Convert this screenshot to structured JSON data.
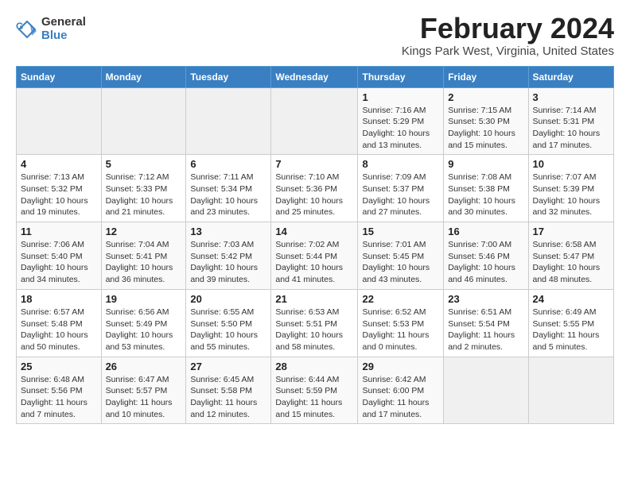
{
  "logo": {
    "general": "General",
    "blue": "Blue"
  },
  "title": "February 2024",
  "subtitle": "Kings Park West, Virginia, United States",
  "days_of_week": [
    "Sunday",
    "Monday",
    "Tuesday",
    "Wednesday",
    "Thursday",
    "Friday",
    "Saturday"
  ],
  "weeks": [
    [
      {
        "day": "",
        "info": ""
      },
      {
        "day": "",
        "info": ""
      },
      {
        "day": "",
        "info": ""
      },
      {
        "day": "",
        "info": ""
      },
      {
        "day": "1",
        "info": "Sunrise: 7:16 AM\nSunset: 5:29 PM\nDaylight: 10 hours\nand 13 minutes."
      },
      {
        "day": "2",
        "info": "Sunrise: 7:15 AM\nSunset: 5:30 PM\nDaylight: 10 hours\nand 15 minutes."
      },
      {
        "day": "3",
        "info": "Sunrise: 7:14 AM\nSunset: 5:31 PM\nDaylight: 10 hours\nand 17 minutes."
      }
    ],
    [
      {
        "day": "4",
        "info": "Sunrise: 7:13 AM\nSunset: 5:32 PM\nDaylight: 10 hours\nand 19 minutes."
      },
      {
        "day": "5",
        "info": "Sunrise: 7:12 AM\nSunset: 5:33 PM\nDaylight: 10 hours\nand 21 minutes."
      },
      {
        "day": "6",
        "info": "Sunrise: 7:11 AM\nSunset: 5:34 PM\nDaylight: 10 hours\nand 23 minutes."
      },
      {
        "day": "7",
        "info": "Sunrise: 7:10 AM\nSunset: 5:36 PM\nDaylight: 10 hours\nand 25 minutes."
      },
      {
        "day": "8",
        "info": "Sunrise: 7:09 AM\nSunset: 5:37 PM\nDaylight: 10 hours\nand 27 minutes."
      },
      {
        "day": "9",
        "info": "Sunrise: 7:08 AM\nSunset: 5:38 PM\nDaylight: 10 hours\nand 30 minutes."
      },
      {
        "day": "10",
        "info": "Sunrise: 7:07 AM\nSunset: 5:39 PM\nDaylight: 10 hours\nand 32 minutes."
      }
    ],
    [
      {
        "day": "11",
        "info": "Sunrise: 7:06 AM\nSunset: 5:40 PM\nDaylight: 10 hours\nand 34 minutes."
      },
      {
        "day": "12",
        "info": "Sunrise: 7:04 AM\nSunset: 5:41 PM\nDaylight: 10 hours\nand 36 minutes."
      },
      {
        "day": "13",
        "info": "Sunrise: 7:03 AM\nSunset: 5:42 PM\nDaylight: 10 hours\nand 39 minutes."
      },
      {
        "day": "14",
        "info": "Sunrise: 7:02 AM\nSunset: 5:44 PM\nDaylight: 10 hours\nand 41 minutes."
      },
      {
        "day": "15",
        "info": "Sunrise: 7:01 AM\nSunset: 5:45 PM\nDaylight: 10 hours\nand 43 minutes."
      },
      {
        "day": "16",
        "info": "Sunrise: 7:00 AM\nSunset: 5:46 PM\nDaylight: 10 hours\nand 46 minutes."
      },
      {
        "day": "17",
        "info": "Sunrise: 6:58 AM\nSunset: 5:47 PM\nDaylight: 10 hours\nand 48 minutes."
      }
    ],
    [
      {
        "day": "18",
        "info": "Sunrise: 6:57 AM\nSunset: 5:48 PM\nDaylight: 10 hours\nand 50 minutes."
      },
      {
        "day": "19",
        "info": "Sunrise: 6:56 AM\nSunset: 5:49 PM\nDaylight: 10 hours\nand 53 minutes."
      },
      {
        "day": "20",
        "info": "Sunrise: 6:55 AM\nSunset: 5:50 PM\nDaylight: 10 hours\nand 55 minutes."
      },
      {
        "day": "21",
        "info": "Sunrise: 6:53 AM\nSunset: 5:51 PM\nDaylight: 10 hours\nand 58 minutes."
      },
      {
        "day": "22",
        "info": "Sunrise: 6:52 AM\nSunset: 5:53 PM\nDaylight: 11 hours\nand 0 minutes."
      },
      {
        "day": "23",
        "info": "Sunrise: 6:51 AM\nSunset: 5:54 PM\nDaylight: 11 hours\nand 2 minutes."
      },
      {
        "day": "24",
        "info": "Sunrise: 6:49 AM\nSunset: 5:55 PM\nDaylight: 11 hours\nand 5 minutes."
      }
    ],
    [
      {
        "day": "25",
        "info": "Sunrise: 6:48 AM\nSunset: 5:56 PM\nDaylight: 11 hours\nand 7 minutes."
      },
      {
        "day": "26",
        "info": "Sunrise: 6:47 AM\nSunset: 5:57 PM\nDaylight: 11 hours\nand 10 minutes."
      },
      {
        "day": "27",
        "info": "Sunrise: 6:45 AM\nSunset: 5:58 PM\nDaylight: 11 hours\nand 12 minutes."
      },
      {
        "day": "28",
        "info": "Sunrise: 6:44 AM\nSunset: 5:59 PM\nDaylight: 11 hours\nand 15 minutes."
      },
      {
        "day": "29",
        "info": "Sunrise: 6:42 AM\nSunset: 6:00 PM\nDaylight: 11 hours\nand 17 minutes."
      },
      {
        "day": "",
        "info": ""
      },
      {
        "day": "",
        "info": ""
      }
    ]
  ]
}
